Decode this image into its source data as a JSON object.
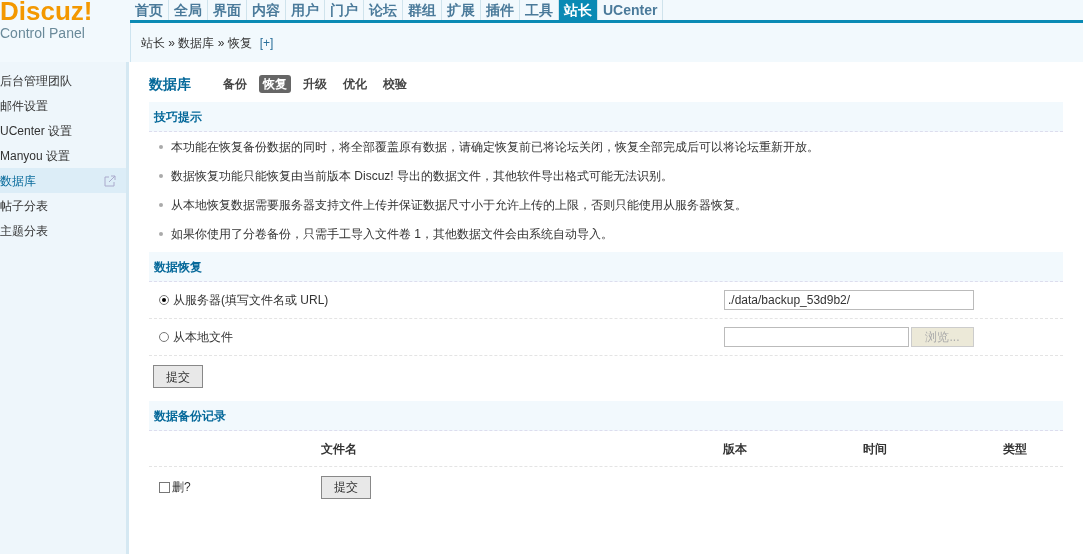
{
  "logo": {
    "name": "Discuz!",
    "subtitle": "Control Panel"
  },
  "nav": [
    {
      "label": "首页",
      "selected": false
    },
    {
      "label": "全局",
      "selected": false
    },
    {
      "label": "界面",
      "selected": false
    },
    {
      "label": "内容",
      "selected": false
    },
    {
      "label": "用户",
      "selected": false
    },
    {
      "label": "门户",
      "selected": false
    },
    {
      "label": "论坛",
      "selected": false
    },
    {
      "label": "群组",
      "selected": false
    },
    {
      "label": "扩展",
      "selected": false
    },
    {
      "label": "插件",
      "selected": false
    },
    {
      "label": "工具",
      "selected": false
    },
    {
      "label": "站长",
      "selected": true
    },
    {
      "label": "UCenter",
      "selected": false
    }
  ],
  "breadcrumb": {
    "text": "站长 » 数据库 » 恢复",
    "add": "[+]"
  },
  "sidebar": {
    "items": [
      {
        "label": "后台管理团队",
        "selected": false
      },
      {
        "label": "邮件设置",
        "selected": false
      },
      {
        "label": "UCenter 设置",
        "selected": false
      },
      {
        "label": "Manyou 设置",
        "selected": false
      },
      {
        "label": "数据库",
        "selected": true
      },
      {
        "label": "帖子分表",
        "selected": false
      },
      {
        "label": "主题分表",
        "selected": false
      }
    ]
  },
  "page": {
    "title": "数据库",
    "tabs": [
      {
        "label": "备份",
        "selected": false
      },
      {
        "label": "恢复",
        "selected": true
      },
      {
        "label": "升级",
        "selected": false
      },
      {
        "label": "优化",
        "selected": false
      },
      {
        "label": "校验",
        "selected": false
      }
    ]
  },
  "tips": {
    "title": "技巧提示",
    "items": [
      "本功能在恢复备份数据的同时，将全部覆盖原有数据，请确定恢复前已将论坛关闭，恢复全部完成后可以将论坛重新开放。",
      "数据恢复功能只能恢复由当前版本 Discuz! 导出的数据文件，其他软件导出格式可能无法识别。",
      "从本地恢复数据需要服务器支持文件上传并保证数据尺寸小于允许上传的上限，否则只能使用从服务器恢复。",
      "如果你使用了分卷备份，只需手工导入文件卷 1，其他数据文件会由系统自动导入。"
    ]
  },
  "restore": {
    "title": "数据恢复",
    "options": [
      {
        "kind": "text",
        "label": "从服务器(填写文件名或 URL)",
        "selected": true,
        "value": "./data/backup_53d9b2/"
      },
      {
        "kind": "file",
        "label": "从本地文件",
        "selected": false,
        "button": "浏览..."
      }
    ],
    "submit": "提交"
  },
  "records": {
    "title": "数据备份记录",
    "columns": [
      "文件名",
      "版本",
      "时间",
      "类型"
    ],
    "delete_label": "删?",
    "delete_checked": false,
    "submit": "提交"
  }
}
